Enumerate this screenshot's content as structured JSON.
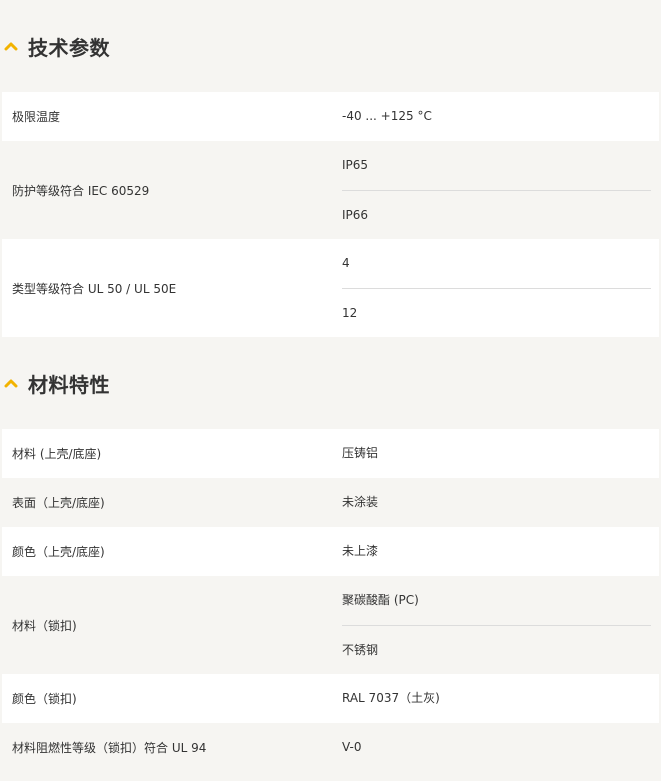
{
  "sections": [
    {
      "title": "技术参数",
      "rows": [
        {
          "label": "极限温度",
          "values": [
            "-40 ... +125 °C"
          ]
        },
        {
          "label": "防护等级符合 IEC 60529",
          "values": [
            "IP65",
            "IP66"
          ]
        },
        {
          "label": "类型等级符合 UL 50 / UL 50E",
          "values": [
            "4",
            "12"
          ]
        }
      ]
    },
    {
      "title": "材料特性",
      "rows": [
        {
          "label": "材料 (上壳/底座)",
          "values": [
            "压铸铝"
          ]
        },
        {
          "label": "表面（上壳/底座)",
          "values": [
            "未涂装"
          ]
        },
        {
          "label": "颜色（上壳/底座)",
          "values": [
            "未上漆"
          ]
        },
        {
          "label": "材料（锁扣)",
          "values": [
            "聚碳酸酯 (PC)",
            "不锈钢"
          ]
        },
        {
          "label": "颜色（锁扣)",
          "values": [
            "RAL 7037（土灰)"
          ]
        },
        {
          "label": "材料阻燃性等级（锁扣）符合 UL 94",
          "values": [
            "V-0"
          ]
        }
      ]
    }
  ],
  "colors": {
    "accent": "#f2b300",
    "stripe_light": "#ffffff",
    "stripe_dark": "#f6f5f2"
  },
  "icons": {
    "section_toggle": "chevron-up-icon"
  }
}
